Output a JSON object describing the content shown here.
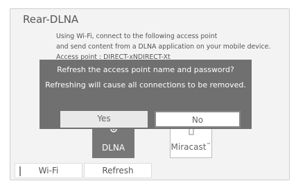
{
  "screen": {
    "title": "Rear-DLNA"
  },
  "instructions": {
    "line1": "Using Wi-Fi, connect to the following access point",
    "line2": "and send content from a DLNA application on your mobile device.",
    "line3": "Access point : DIRECT-xNDIRECT-Xt"
  },
  "apps": [
    {
      "label": "DLNA",
      "icon": "cast-icon",
      "selected": true
    },
    {
      "label": "Miracast",
      "trademark": "™",
      "icon": "phone-cast-icon",
      "selected": false
    }
  ],
  "bottom_tabs": [
    {
      "label": "Wi-Fi"
    },
    {
      "label": "Refresh"
    }
  ],
  "dialog": {
    "message": "Refresh the access point name and password?",
    "submessage": "Refreshing will cause all connections to be removed.",
    "yes_label": "Yes",
    "no_label": "No"
  },
  "colors": {
    "dialog_bg": "#707070",
    "selected_tile": "#777777",
    "frame_bg": "#f3f3f3"
  }
}
